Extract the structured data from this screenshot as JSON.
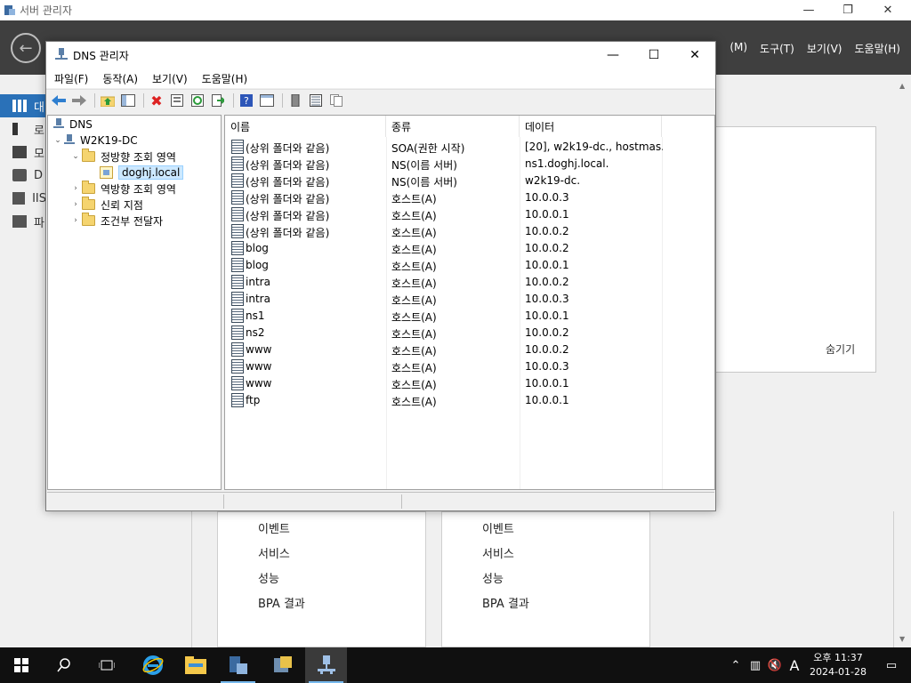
{
  "server_manager": {
    "title": "서버 관리자",
    "menu": [
      "(M)",
      "도구(T)",
      "보기(V)",
      "도움말(H)"
    ],
    "sidebar": [
      {
        "label": "대",
        "active": true
      },
      {
        "label": "로"
      },
      {
        "label": "모"
      },
      {
        "label": "D"
      },
      {
        "label": "IIS"
      },
      {
        "label": "파"
      }
    ],
    "hide_label": "숨기기",
    "cards": [
      {
        "links": [
          "이벤트",
          "서비스",
          "성능",
          "BPA 결과"
        ]
      },
      {
        "links": [
          "이벤트",
          "서비스",
          "성능",
          "BPA 결과"
        ]
      }
    ]
  },
  "dns_manager": {
    "title": "DNS 관리자",
    "menu": [
      "파일(F)",
      "동작(A)",
      "보기(V)",
      "도움말(H)"
    ],
    "tree": {
      "root": "DNS",
      "server": "W2K19-DC",
      "forward_zones": "정방향 조회 영역",
      "zone": "doghj.local",
      "reverse_zones": "역방향 조회 영역",
      "trust_points": "신뢰 지점",
      "conditional_forwarders": "조건부 전달자"
    },
    "columns": [
      "이름",
      "종류",
      "데이터"
    ],
    "records": [
      {
        "name": "(상위 폴더와 같음)",
        "type": "SOA(권한 시작)",
        "data": "[20], w2k19-dc., hostmas..."
      },
      {
        "name": "(상위 폴더와 같음)",
        "type": "NS(이름 서버)",
        "data": "ns1.doghj.local."
      },
      {
        "name": "(상위 폴더와 같음)",
        "type": "NS(이름 서버)",
        "data": "w2k19-dc."
      },
      {
        "name": "(상위 폴더와 같음)",
        "type": "호스트(A)",
        "data": "10.0.0.3"
      },
      {
        "name": "(상위 폴더와 같음)",
        "type": "호스트(A)",
        "data": "10.0.0.1"
      },
      {
        "name": "(상위 폴더와 같음)",
        "type": "호스트(A)",
        "data": "10.0.0.2"
      },
      {
        "name": "blog",
        "type": "호스트(A)",
        "data": "10.0.0.2"
      },
      {
        "name": "blog",
        "type": "호스트(A)",
        "data": "10.0.0.1"
      },
      {
        "name": "intra",
        "type": "호스트(A)",
        "data": "10.0.0.2"
      },
      {
        "name": "intra",
        "type": "호스트(A)",
        "data": "10.0.0.3"
      },
      {
        "name": "ns1",
        "type": "호스트(A)",
        "data": "10.0.0.1"
      },
      {
        "name": "ns2",
        "type": "호스트(A)",
        "data": "10.0.0.2"
      },
      {
        "name": "www",
        "type": "호스트(A)",
        "data": "10.0.0.2"
      },
      {
        "name": "www",
        "type": "호스트(A)",
        "data": "10.0.0.3"
      },
      {
        "name": "www",
        "type": "호스트(A)",
        "data": "10.0.0.1"
      },
      {
        "name": "ftp",
        "type": "호스트(A)",
        "data": "10.0.0.1"
      }
    ]
  },
  "taskbar": {
    "ime": "A",
    "time": "오후 11:37",
    "date": "2024-01-28"
  }
}
